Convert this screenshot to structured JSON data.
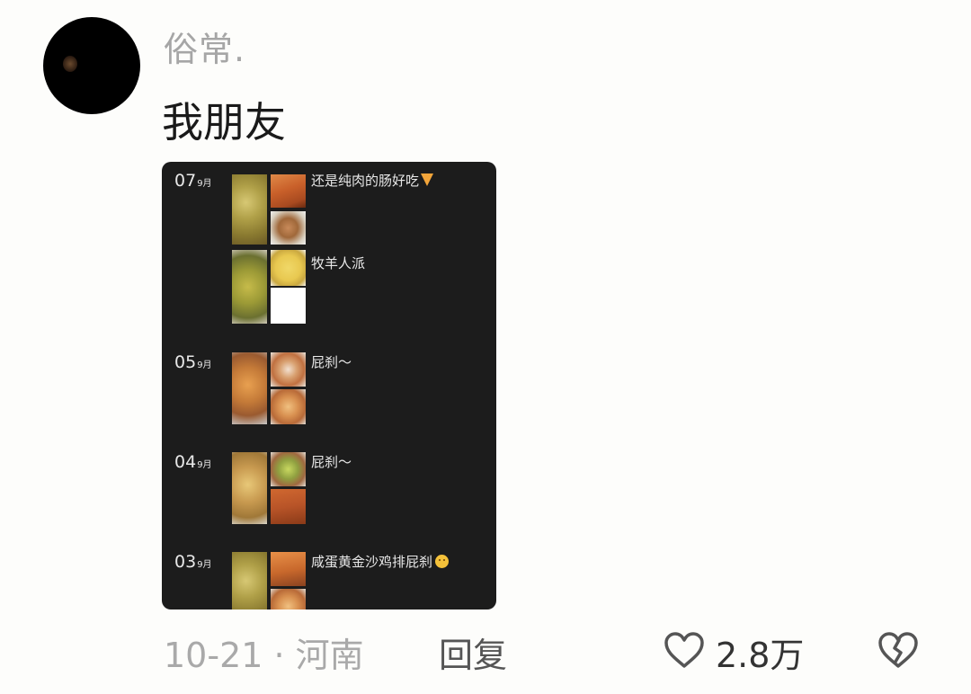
{
  "comment": {
    "username": "俗常.",
    "text": "我朋友",
    "timestamp": "10-21 · 河南",
    "reply_label": "回复",
    "like_count": "2.8万",
    "like_icon": "heart-outline-icon",
    "dislike_icon": "broken-heart-icon"
  },
  "attachment": {
    "posts": [
      {
        "date": "07",
        "month": "9月",
        "entries": [
          {
            "caption": "还是纯肉的肠好吃",
            "emoji": "pizza"
          },
          {
            "caption": "牧羊人派",
            "emoji": ""
          }
        ]
      },
      {
        "date": "05",
        "month": "9月",
        "entries": [
          {
            "caption": "屁刹～",
            "emoji": ""
          }
        ]
      },
      {
        "date": "04",
        "month": "9月",
        "entries": [
          {
            "caption": "屁刹～",
            "emoji": ""
          }
        ]
      },
      {
        "date": "03",
        "month": "9月",
        "entries": [
          {
            "caption": "咸蛋黄金沙鸡排屁刹",
            "emoji": "smiley"
          }
        ]
      }
    ]
  },
  "colors": {
    "background": "#fdfdfb",
    "username": "#a6a6a6",
    "text": "#1a1a1a",
    "meta": "#a9a9a9",
    "image_bg": "#1c1c1c"
  }
}
